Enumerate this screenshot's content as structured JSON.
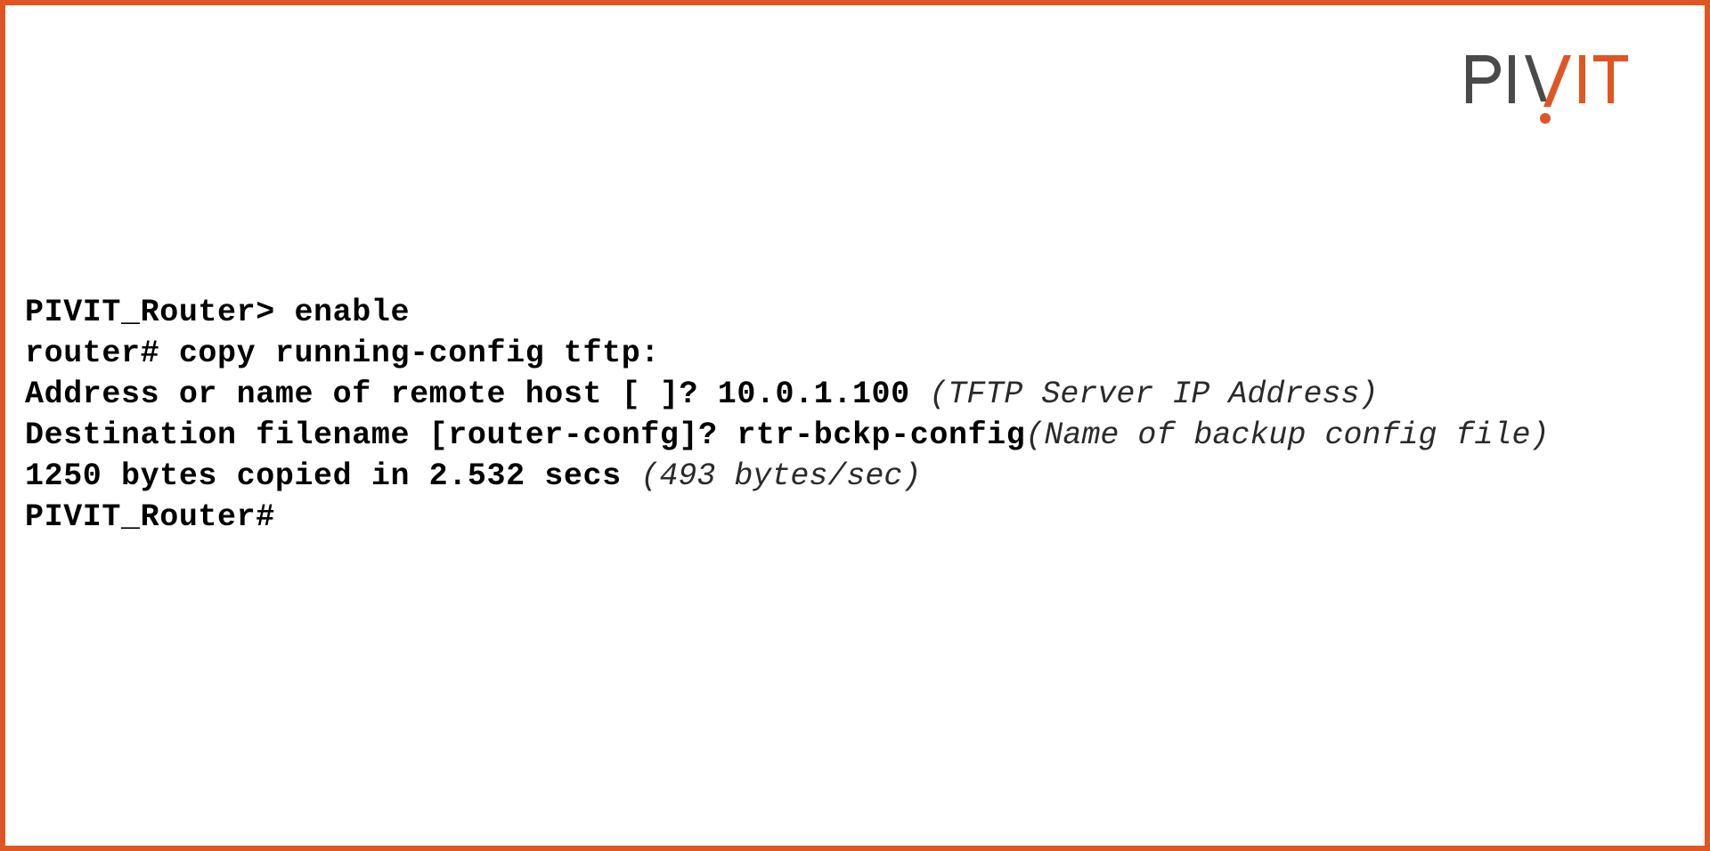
{
  "page": {
    "background_color": "#ffffff",
    "border_color": "#e05524",
    "border_width_px": 6
  },
  "logo": {
    "name": "PIVIT",
    "text_dark": "PI",
    "text_orange": "IT",
    "dark_color": "#4a4a4a",
    "orange_color": "#e05524",
    "accent_mark": "V-slash-with-dot"
  },
  "terminal": {
    "font_color": "#000000",
    "note_color": "#2a2a2a",
    "lines": [
      {
        "id": "line-1",
        "command": "PIVIT_Router> enable",
        "note": ""
      },
      {
        "id": "line-2",
        "command": "router# copy running-config tftp:",
        "note": ""
      },
      {
        "id": "line-3",
        "command": "Address or name of remote host [ ]? 10.0.1.100 ",
        "note": "(TFTP Server IP Address)"
      },
      {
        "id": "line-4",
        "command": "Destination filename [router-confg]? rtr-bckp-config",
        "note": "(Name of backup config file)"
      },
      {
        "id": "line-5",
        "command": "1250 bytes copied in 2.532 secs ",
        "note": "(493 bytes/sec)"
      },
      {
        "id": "line-6",
        "command": "PIVIT_Router#",
        "note": ""
      }
    ]
  }
}
